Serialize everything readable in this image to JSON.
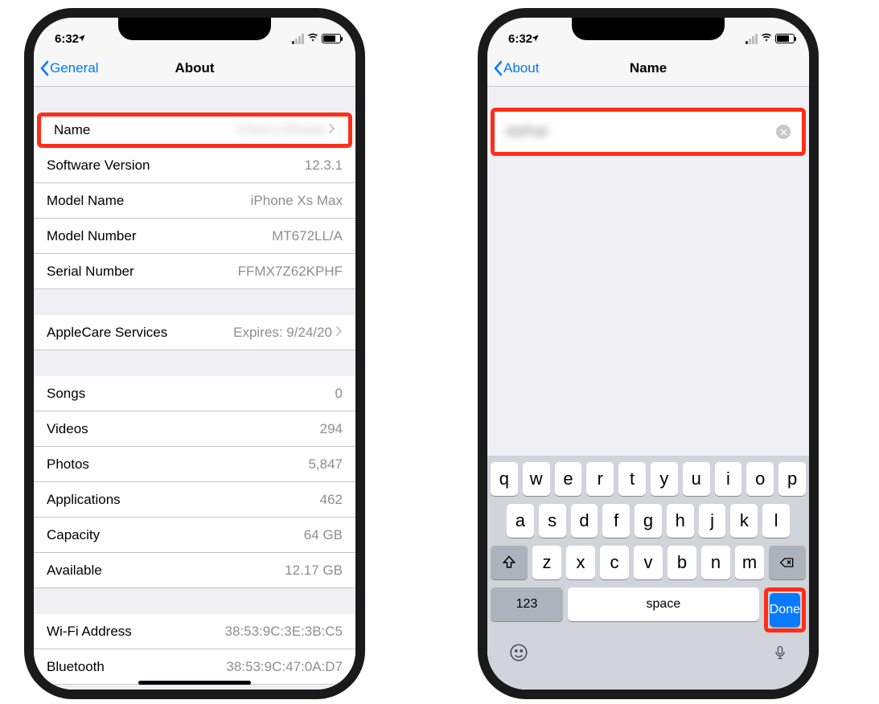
{
  "left": {
    "status_time": "6:32",
    "nav_back": "General",
    "nav_title": "About",
    "rows1": [
      {
        "label": "Name",
        "value": "Chris's iPhone",
        "chevron": true,
        "blur": true,
        "highlight": true
      },
      {
        "label": "Software Version",
        "value": "12.3.1"
      },
      {
        "label": "Model Name",
        "value": "iPhone Xs Max"
      },
      {
        "label": "Model Number",
        "value": "MT672LL/A"
      },
      {
        "label": "Serial Number",
        "value": "FFMX7Z62KPHF"
      }
    ],
    "rows2": [
      {
        "label": "AppleCare Services",
        "value": "Expires: 9/24/20",
        "chevron": true
      }
    ],
    "rows3": [
      {
        "label": "Songs",
        "value": "0"
      },
      {
        "label": "Videos",
        "value": "294"
      },
      {
        "label": "Photos",
        "value": "5,847"
      },
      {
        "label": "Applications",
        "value": "462"
      },
      {
        "label": "Capacity",
        "value": "64 GB"
      },
      {
        "label": "Available",
        "value": "12.17 GB"
      }
    ],
    "rows4": [
      {
        "label": "Wi-Fi Address",
        "value": "38:53:9C:3E:3B:C5"
      },
      {
        "label": "Bluetooth",
        "value": "38:53:9C:47:0A:D7"
      }
    ]
  },
  "right": {
    "status_time": "6:32",
    "nav_back": "About",
    "nav_title": "Name",
    "input_value": "AirPod",
    "keyboard": {
      "row1": [
        "q",
        "w",
        "e",
        "r",
        "t",
        "y",
        "u",
        "i",
        "o",
        "p"
      ],
      "row2": [
        "a",
        "s",
        "d",
        "f",
        "g",
        "h",
        "j",
        "k",
        "l"
      ],
      "row3": [
        "z",
        "x",
        "c",
        "v",
        "b",
        "n",
        "m"
      ],
      "k123": "123",
      "space": "space",
      "done": "Done"
    }
  }
}
